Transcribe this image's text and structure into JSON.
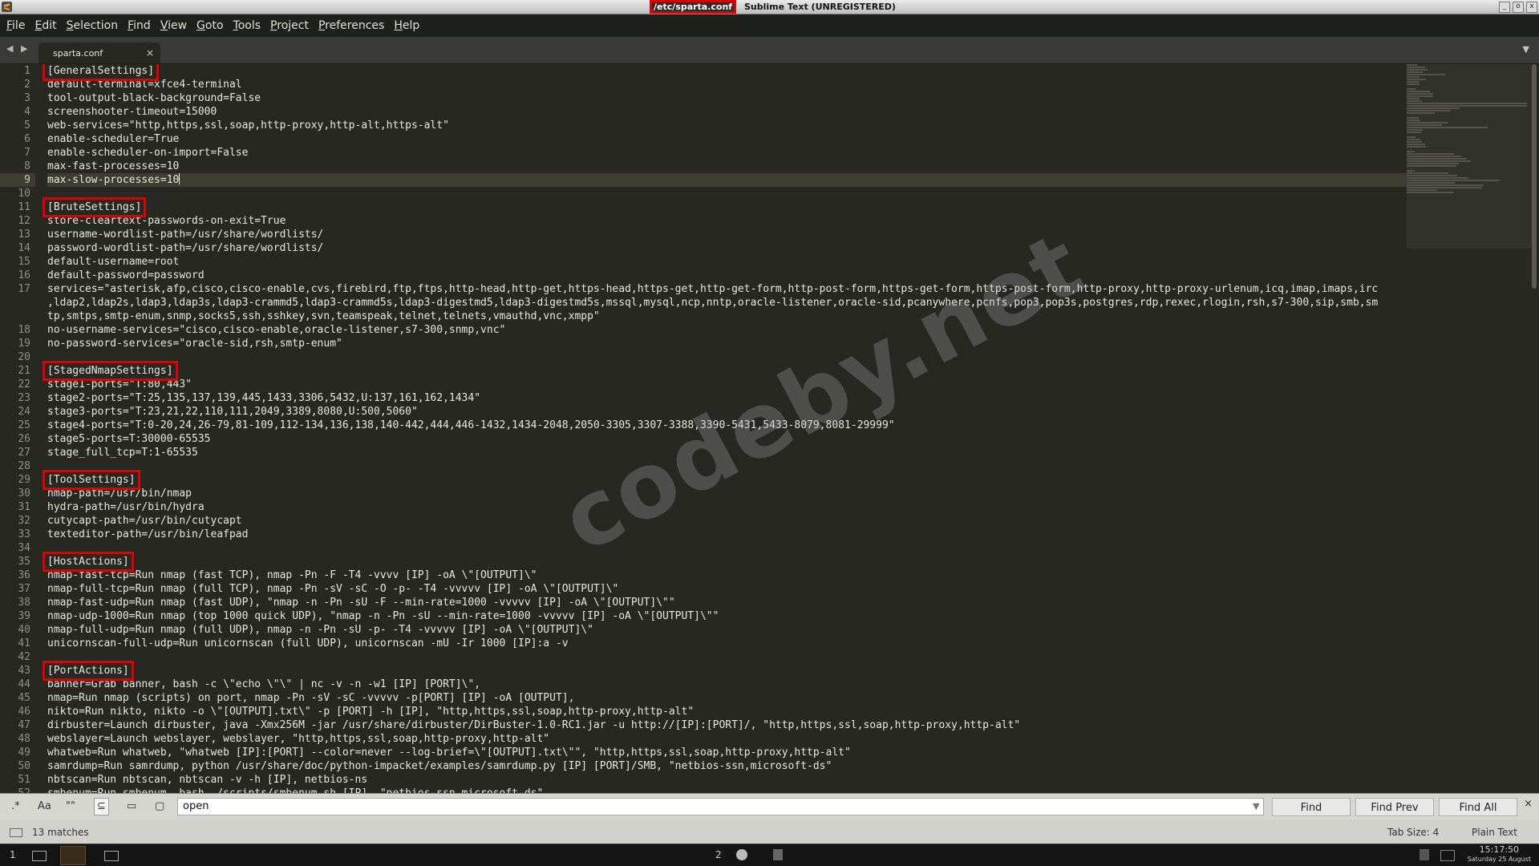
{
  "window": {
    "title_path": "/etc/sparta.conf",
    "title_app": "Sublime Text (UNREGISTERED)",
    "buttons": [
      "_",
      "o",
      "x"
    ]
  },
  "menu": {
    "items": [
      {
        "u": "F",
        "rest": "ile"
      },
      {
        "u": "E",
        "rest": "dit"
      },
      {
        "u": "S",
        "rest": "election"
      },
      {
        "u": "F",
        "rest": "ind"
      },
      {
        "u": "V",
        "rest": "iew"
      },
      {
        "u": "G",
        "rest": "oto"
      },
      {
        "u": "T",
        "rest": "ools"
      },
      {
        "u": "P",
        "rest": "roject"
      },
      {
        "u": "P",
        "rest": "references"
      },
      {
        "u": "H",
        "rest": "elp"
      }
    ]
  },
  "tabs": {
    "nav": "◀ ▶",
    "active": {
      "label": "sparta.conf",
      "close": "×"
    },
    "overflow": "▼"
  },
  "editor": {
    "current_line": 9,
    "lines": [
      {
        "n": 1,
        "section": "[GeneralSettings]"
      },
      {
        "n": 2,
        "text": "default-terminal=xfce4-terminal"
      },
      {
        "n": 3,
        "text": "tool-output-black-background=False"
      },
      {
        "n": 4,
        "text": "screenshooter-timeout=15000"
      },
      {
        "n": 5,
        "text": "web-services=\"http,https,ssl,soap,http-proxy,http-alt,https-alt\""
      },
      {
        "n": 6,
        "text": "enable-scheduler=True"
      },
      {
        "n": 7,
        "text": "enable-scheduler-on-import=False"
      },
      {
        "n": 8,
        "text": "max-fast-processes=10"
      },
      {
        "n": 9,
        "text": "max-slow-processes=10"
      },
      {
        "n": 10,
        "text": ""
      },
      {
        "n": 11,
        "section": "[BruteSettings]"
      },
      {
        "n": 12,
        "text": "store-cleartext-passwords-on-exit=True"
      },
      {
        "n": 13,
        "text": "username-wordlist-path=/usr/share/wordlists/"
      },
      {
        "n": 14,
        "text": "password-wordlist-path=/usr/share/wordlists/"
      },
      {
        "n": 15,
        "text": "default-username=root"
      },
      {
        "n": 16,
        "text": "default-password=password"
      },
      {
        "n": 17,
        "text": "services=\"asterisk,afp,cisco,cisco-enable,cvs,firebird,ftp,ftps,http-head,http-get,https-head,https-get,http-get-form,http-post-form,https-get-form,https-post-form,http-proxy,http-proxy-urlenum,icq,imap,imaps,irc"
      },
      {
        "n": "",
        "text": ",ldap2,ldap2s,ldap3,ldap3s,ldap3-crammd5,ldap3-crammd5s,ldap3-digestmd5,ldap3-digestmd5s,mssql,mysql,ncp,nntp,oracle-listener,oracle-sid,pcanywhere,pcnfs,pop3,pop3s,postgres,rdp,rexec,rlogin,rsh,s7-300,sip,smb,sm"
      },
      {
        "n": "",
        "text": "tp,smtps,smtp-enum,snmp,socks5,ssh,sshkey,svn,teamspeak,telnet,telnets,vmauthd,vnc,xmpp\""
      },
      {
        "n": 18,
        "text": "no-username-services=\"cisco,cisco-enable,oracle-listener,s7-300,snmp,vnc\""
      },
      {
        "n": 19,
        "text": "no-password-services=\"oracle-sid,rsh,smtp-enum\""
      },
      {
        "n": 20,
        "text": ""
      },
      {
        "n": 21,
        "section": "[StagedNmapSettings]"
      },
      {
        "n": 22,
        "text": "stage1-ports=\"T:80,443\""
      },
      {
        "n": 23,
        "text": "stage2-ports=\"T:25,135,137,139,445,1433,3306,5432,U:137,161,162,1434\""
      },
      {
        "n": 24,
        "text": "stage3-ports=\"T:23,21,22,110,111,2049,3389,8080,U:500,5060\""
      },
      {
        "n": 25,
        "text": "stage4-ports=\"T:0-20,24,26-79,81-109,112-134,136,138,140-442,444,446-1432,1434-2048,2050-3305,3307-3388,3390-5431,5433-8079,8081-29999\""
      },
      {
        "n": 26,
        "text": "stage5-ports=T:30000-65535"
      },
      {
        "n": 27,
        "text": "stage_full_tcp=T:1-65535"
      },
      {
        "n": 28,
        "text": ""
      },
      {
        "n": 29,
        "section": "[ToolSettings]"
      },
      {
        "n": 30,
        "text": "nmap-path=/usr/bin/nmap"
      },
      {
        "n": 31,
        "text": "hydra-path=/usr/bin/hydra"
      },
      {
        "n": 32,
        "text": "cutycapt-path=/usr/bin/cutycapt"
      },
      {
        "n": 33,
        "text": "texteditor-path=/usr/bin/leafpad"
      },
      {
        "n": 34,
        "text": ""
      },
      {
        "n": 35,
        "section": "[HostActions]"
      },
      {
        "n": 36,
        "text": "nmap-fast-tcp=Run nmap (fast TCP), nmap -Pn -F -T4 -vvvv [IP] -oA \\\"[OUTPUT]\\\""
      },
      {
        "n": 37,
        "text": "nmap-full-tcp=Run nmap (full TCP), nmap -Pn -sV -sC -O -p- -T4 -vvvvv [IP] -oA \\\"[OUTPUT]\\\""
      },
      {
        "n": 38,
        "text": "nmap-fast-udp=Run nmap (fast UDP), \"nmap -n -Pn -sU -F --min-rate=1000 -vvvvv [IP] -oA \\\"[OUTPUT]\\\"\""
      },
      {
        "n": 39,
        "text": "nmap-udp-1000=Run nmap (top 1000 quick UDP), \"nmap -n -Pn -sU --min-rate=1000 -vvvvv [IP] -oA \\\"[OUTPUT]\\\"\""
      },
      {
        "n": 40,
        "text": "nmap-full-udp=Run nmap (full UDP), nmap -n -Pn -sU -p- -T4 -vvvvv [IP] -oA \\\"[OUTPUT]\\\""
      },
      {
        "n": 41,
        "text": "unicornscan-full-udp=Run unicornscan (full UDP), unicornscan -mU -Ir 1000 [IP]:a -v"
      },
      {
        "n": 42,
        "text": ""
      },
      {
        "n": 43,
        "section": "[PortActions]"
      },
      {
        "n": 44,
        "text": "banner=Grab banner, bash -c \\\"echo \\\"\\\" | nc -v -n -w1 [IP] [PORT]\\\","
      },
      {
        "n": 45,
        "text": "nmap=Run nmap (scripts) on port, nmap -Pn -sV -sC -vvvvv -p[PORT] [IP] -oA [OUTPUT],"
      },
      {
        "n": 46,
        "text": "nikto=Run nikto, nikto -o \\\"[OUTPUT].txt\\\" -p [PORT] -h [IP], \"http,https,ssl,soap,http-proxy,http-alt\""
      },
      {
        "n": 47,
        "text": "dirbuster=Launch dirbuster, java -Xmx256M -jar /usr/share/dirbuster/DirBuster-1.0-RC1.jar -u http://[IP]:[PORT]/, \"http,https,ssl,soap,http-proxy,http-alt\""
      },
      {
        "n": 48,
        "text": "webslayer=Launch webslayer, webslayer, \"http,https,ssl,soap,http-proxy,http-alt\""
      },
      {
        "n": 49,
        "text": "whatweb=Run whatweb, \"whatweb [IP]:[PORT] --color=never --log-brief=\\\"[OUTPUT].txt\\\"\", \"http,https,ssl,soap,http-proxy,http-alt\""
      },
      {
        "n": 50,
        "text": "samrdump=Run samrdump, python /usr/share/doc/python-impacket/examples/samrdump.py [IP] [PORT]/SMB, \"netbios-ssn,microsoft-ds\""
      },
      {
        "n": 51,
        "text": "nbtscan=Run nbtscan, nbtscan -v -h [IP], netbios-ns"
      },
      {
        "n": 52,
        "text": "smbenum=Run smbenum, bash ./scripts/smbenum.sh [IP], \"netbios-ssn,microsoft-ds\""
      }
    ]
  },
  "find": {
    "options": [
      ".*",
      "Aa",
      "\"\"",
      "⊆",
      "▭",
      "▢"
    ],
    "value": "open",
    "dropdown": "▼",
    "buttons": [
      "Find",
      "Find Prev",
      "Find All"
    ],
    "close": "×"
  },
  "status": {
    "matches": "13 matches",
    "tab_size": "Tab Size: 4",
    "syntax": "Plain Text"
  },
  "taskbar": {
    "workspace1": "1",
    "workspace2": "2",
    "time": "15:17:50",
    "date": "Saturday 25 August"
  },
  "watermark": "codeby.net",
  "colors": {
    "highlight_box": "#e00000",
    "editor_bg": "#272822"
  }
}
